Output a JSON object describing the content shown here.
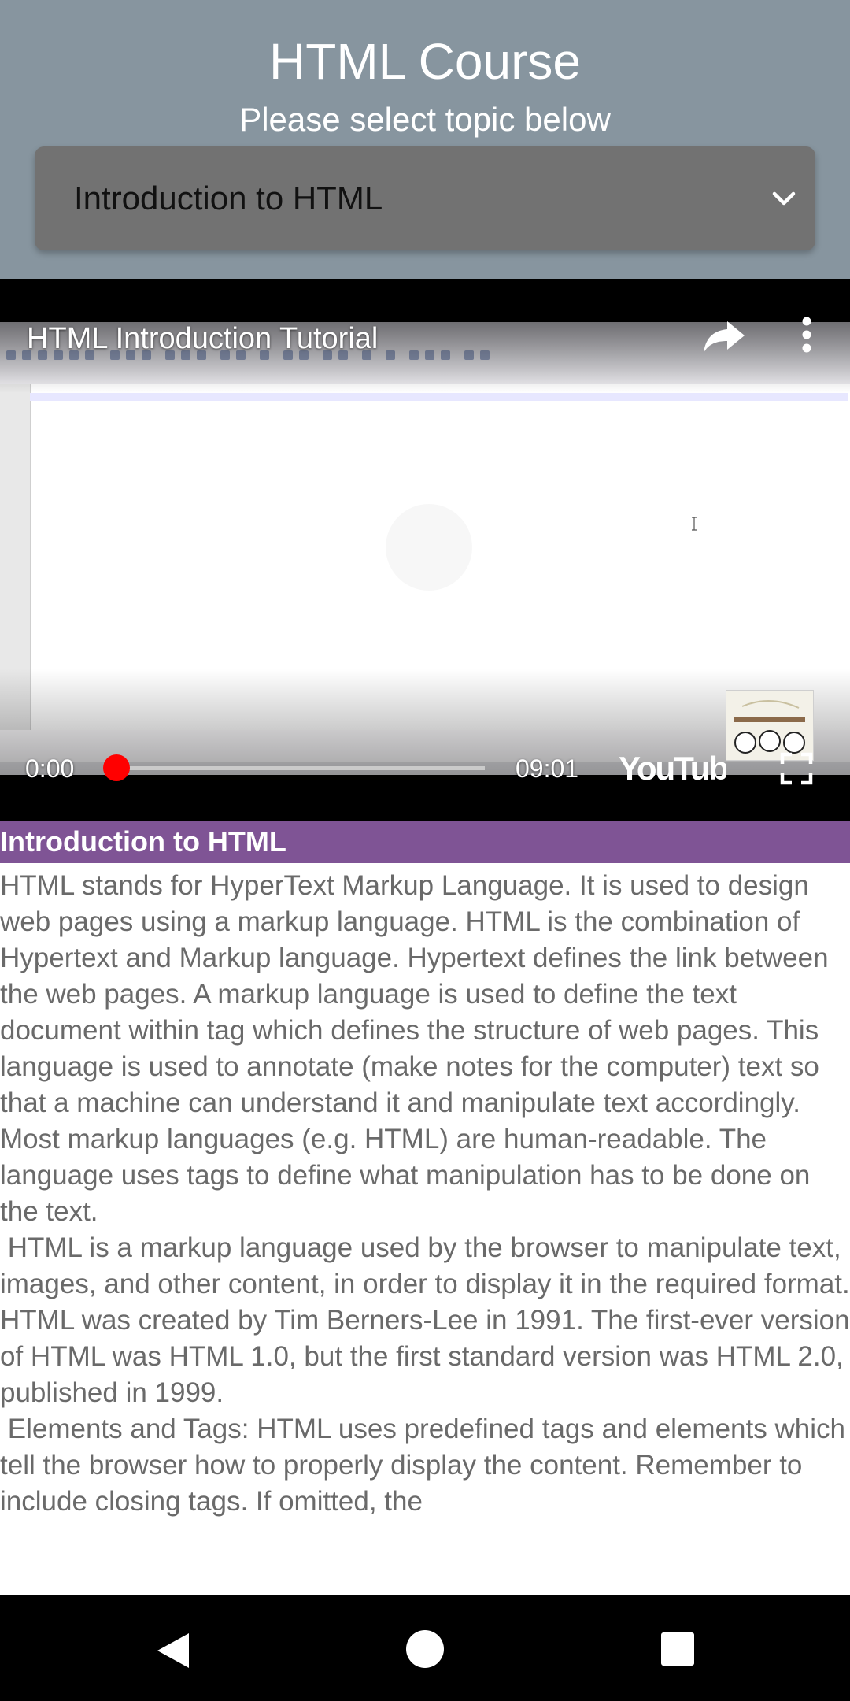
{
  "header": {
    "title": "HTML Course",
    "subtitle": "Please select topic below",
    "topic_select": {
      "selected": "Introduction to HTML",
      "icon": "chevron-down-icon"
    }
  },
  "video": {
    "title": "HTML Introduction Tutorial",
    "current_time": "0:00",
    "duration": "09:01",
    "progress_fraction": 0.0,
    "brand": "YouTube",
    "icons": [
      "share-icon",
      "more-vert-icon",
      "fullscreen-icon"
    ],
    "accent_color": "#ff0000"
  },
  "section": {
    "heading": "Introduction to HTML",
    "heading_color": "#7f5495",
    "body": "HTML stands for HyperText Markup Language. It is used to design web pages using a markup language. HTML is the combination of Hypertext and Markup language. Hypertext defines the link between the web pages. A markup language is used to define the text document within tag which defines the structure of web pages. This language is used to annotate (make notes for the computer) text so that a machine can understand it and manipulate text accordingly. Most markup languages (e.g. HTML) are human-readable. The language uses tags to define what manipulation has to be done on the text.\n HTML is a markup language used by the browser to manipulate text, images, and other content, in order to display it in the required format. HTML was created by Tim Berners-Lee in 1991. The first-ever version of HTML was HTML 1.0, but the first standard version was HTML 2.0, published in 1999.\n Elements and Tags: HTML uses predefined tags and elements which tell the browser how to properly display the content. Remember to include closing tags. If omitted, the"
  },
  "navbar": {
    "icons": [
      "back-icon",
      "home-icon",
      "recents-icon"
    ]
  }
}
